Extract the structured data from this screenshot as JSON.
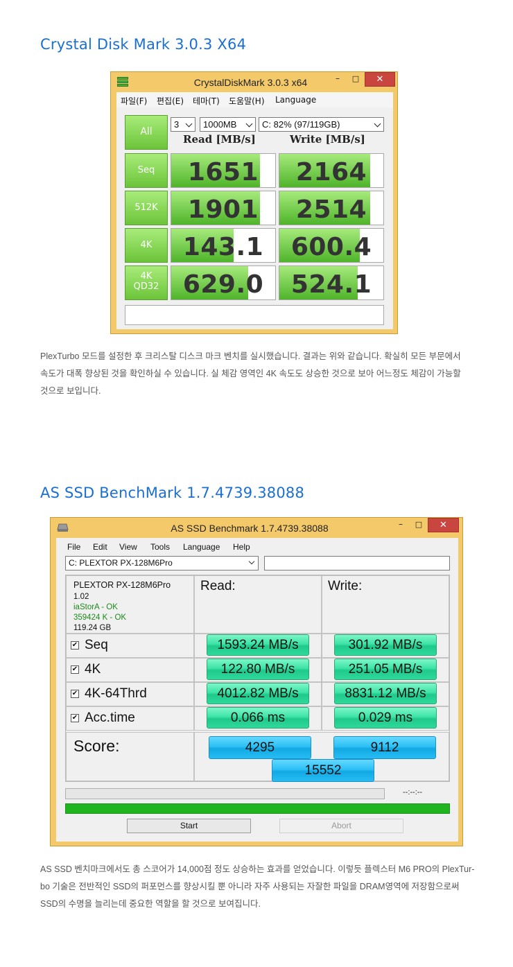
{
  "section1": {
    "heading": "Crystal Disk Mark 3.0.3 X64",
    "paragraph": [
      "PlexTurbo 모드를 설정한 후 크리스탈 디스크 마크 벤치를 실시했습니다. 결과는 위와 같습니다. 확실히 모든 부문에서",
      "속도가 대폭 향상된 것을 확인하실 수 있습니다. 실 체감 영역인 4K 속도도 상승한 것으로 보아 어느정도 체감이 가능할",
      "것으로 보입니다."
    ]
  },
  "cdm": {
    "title": "CrystalDiskMark 3.0.3 x64",
    "window_buttons": {
      "minimize": "–",
      "maximize": "□",
      "close": "✕"
    },
    "menu": [
      "파일(F)",
      "편집(E)",
      "테마(T)",
      "도움말(H)",
      "Language"
    ],
    "all_button": "All",
    "count_select": "3",
    "size_select": "1000MB",
    "drive_select": "C: 82% (97/119GB)",
    "read_header": "Read [MB/s]",
    "write_header": "Write [MB/s]",
    "rows": [
      {
        "label": [
          "Seq"
        ],
        "read": "1651",
        "write": "2164",
        "read_fill": 0.85,
        "write_fill": 0.87
      },
      {
        "label": [
          "512K"
        ],
        "read": "1901",
        "write": "2514",
        "read_fill": 0.85,
        "write_fill": 0.87
      },
      {
        "label": [
          "4K"
        ],
        "read": "143.1",
        "write": "600.4",
        "read_fill": 0.6,
        "write_fill": 0.77
      },
      {
        "label": [
          "4K",
          "QD32"
        ],
        "read": "629.0",
        "write": "524.1",
        "read_fill": 0.74,
        "write_fill": 0.75
      }
    ],
    "colors": {
      "accent_green": "#5cbb32",
      "frame": "#f3c969",
      "close": "#c9453f"
    }
  },
  "section2": {
    "heading": "AS SSD BenchMark 1.7.4739.38088",
    "paragraph": [
      "AS SSD 벤치마크에서도 총 스코어가 14,000점 정도 상승하는 효과를 얻었습니다. 이렇듯 플렉스터 M6 PRO의 PlexTur-",
      "bo 기술은 전반적인 SSD의 퍼포먼스를 향상시킬 뿐 아니라 자주 사용되는 자잘한 파일을 DRAM영역에 저장함으로써",
      "SSD의 수명을 늘리는데 중요한 역할을 할 것으로 보여집니다."
    ]
  },
  "asssd": {
    "title": "AS SSD Benchmark 1.7.4739.38088",
    "window_buttons": {
      "minimize": "–",
      "maximize": "□",
      "close": "✕"
    },
    "menu": [
      "File",
      "Edit",
      "View",
      "Tools",
      "Language",
      "Help"
    ],
    "drive_select": "C: PLEXTOR PX-128M6Pro",
    "info": {
      "model": "PLEXTOR PX-128M6Pro",
      "firmware": "1.02",
      "driver": "iaStorA - OK",
      "alignment": "359424 K - OK",
      "size": "119.24 GB"
    },
    "read_header": "Read:",
    "write_header": "Write:",
    "rows": [
      {
        "label": "Seq",
        "checked": "✔",
        "read": "1593.24 MB/s",
        "write": "301.92 MB/s"
      },
      {
        "label": "4K",
        "checked": "✔",
        "read": "122.80 MB/s",
        "write": "251.05 MB/s"
      },
      {
        "label": "4K-64Thrd",
        "checked": "✔",
        "read": "4012.82 MB/s",
        "write": "8831.12 MB/s"
      },
      {
        "label": "Acc.time",
        "checked": "✔",
        "read": "0.066 ms",
        "write": "0.029 ms"
      }
    ],
    "score_label": "Score:",
    "score_read": "4295",
    "score_write": "9112",
    "score_total": "15552",
    "timer": "--:--:--",
    "progress": 1.0,
    "start_button": "Start",
    "abort_button": "Abort",
    "colors": {
      "result_button": "#3de3a6",
      "score_button": "#2cc0f5",
      "progress": "#1fb51f"
    }
  }
}
